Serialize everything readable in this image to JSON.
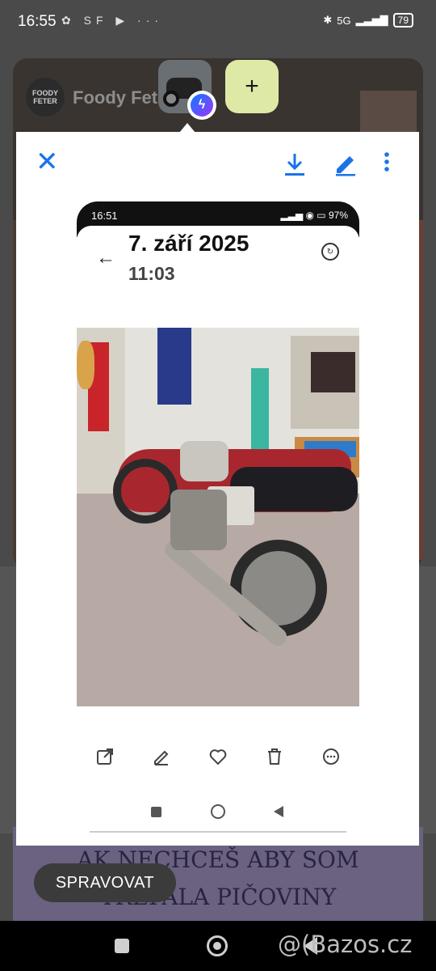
{
  "status_bar": {
    "time": "16:55",
    "left_icons": "✿ SF ▶ ···",
    "signal_label": "5G",
    "battery": "79"
  },
  "background": {
    "author": "Foody Fet",
    "avatar_text": "FOODY FETER",
    "poster_text": "AK NECHCEŠ ABY SOM TREPALA PIČOVINY"
  },
  "chat_heads": {
    "add_label": "+"
  },
  "toolbar": {
    "close_label": "✕"
  },
  "inner_screenshot": {
    "status_time": "16:51",
    "status_right": "▂▃▅ ◉ ▭ 97%",
    "date": "7. září 2025",
    "time": "11:03"
  },
  "manage_button": "SPRAVOVAT",
  "watermark": "@(Bazos.cz",
  "colors": {
    "accent": "#1a73e8",
    "add_button": "#dfe9a6",
    "manage_pill": "#3b3b3b"
  }
}
